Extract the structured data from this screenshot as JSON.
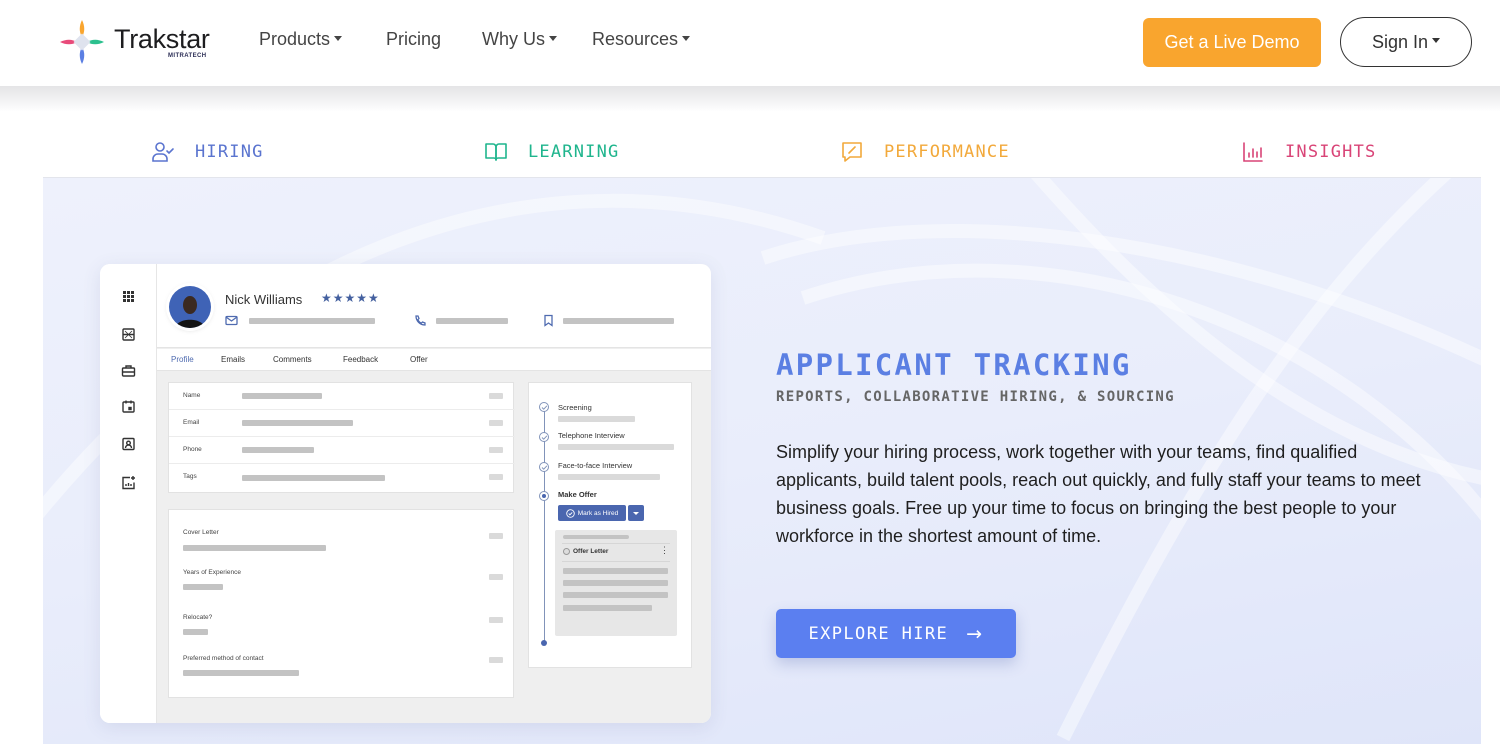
{
  "brand": {
    "name": "Trakstar",
    "sub": "MITRATECH",
    "colors": {
      "orange": "#f9a52e",
      "pink": "#e84b7a",
      "green": "#2cc08e",
      "blue": "#5b7fe3"
    }
  },
  "nav": {
    "items": [
      {
        "label": "Products",
        "dropdown": true
      },
      {
        "label": "Pricing",
        "dropdown": false
      },
      {
        "label": "Why Us",
        "dropdown": true
      },
      {
        "label": "Resources",
        "dropdown": true
      }
    ],
    "demo_label": "Get a Live Demo",
    "signin_label": "Sign In"
  },
  "category_tabs": [
    {
      "label": "HIRING",
      "icon": "user-check-icon",
      "color": "#5a74cf"
    },
    {
      "label": "LEARNING",
      "icon": "book-open-icon",
      "color": "#1fb58d"
    },
    {
      "label": "PERFORMANCE",
      "icon": "message-edit-icon",
      "color": "#f2a93b"
    },
    {
      "label": "INSIGHTS",
      "icon": "bar-chart-icon",
      "color": "#d94477"
    }
  ],
  "mockup": {
    "rail_icons": [
      "grid-icon",
      "inbox-icon",
      "briefcase-icon",
      "calendar-icon",
      "id-badge-icon",
      "report-add-icon"
    ],
    "candidate": {
      "name": "Nick Williams",
      "stars": "★★★★★",
      "rating": 5
    },
    "tabs": [
      "Profile",
      "Emails",
      "Comments",
      "Feedback",
      "Offer"
    ],
    "active_tab": "Profile",
    "fields": [
      "Name",
      "Email",
      "Phone",
      "Tags"
    ],
    "questions": [
      "Cover Letter",
      "Years of Experience",
      "Relocate?",
      "Preferred method of contact"
    ],
    "stages": [
      {
        "label": "Screening",
        "done": true
      },
      {
        "label": "Telephone Interview",
        "done": true
      },
      {
        "label": "Face-to-face Interview",
        "done": true
      },
      {
        "label": "Make Offer",
        "done": false,
        "current": true
      }
    ],
    "mark_hired_label": "Mark as Hired",
    "offer_letter_label": "Offer Letter"
  },
  "hero": {
    "title": "APPLICANT TRACKING",
    "subtitle": "REPORTS, COLLABORATIVE HIRING, & SOURCING",
    "body": "Simplify your hiring process, work together with your teams, find qualified applicants, build talent pools, reach out quickly, and fully staff your teams to meet business goals. Free up your time to focus on bringing the best people to your workforce in the shortest amount of time.",
    "cta_label": "EXPLORE HIRE",
    "cta_arrow": "→"
  }
}
